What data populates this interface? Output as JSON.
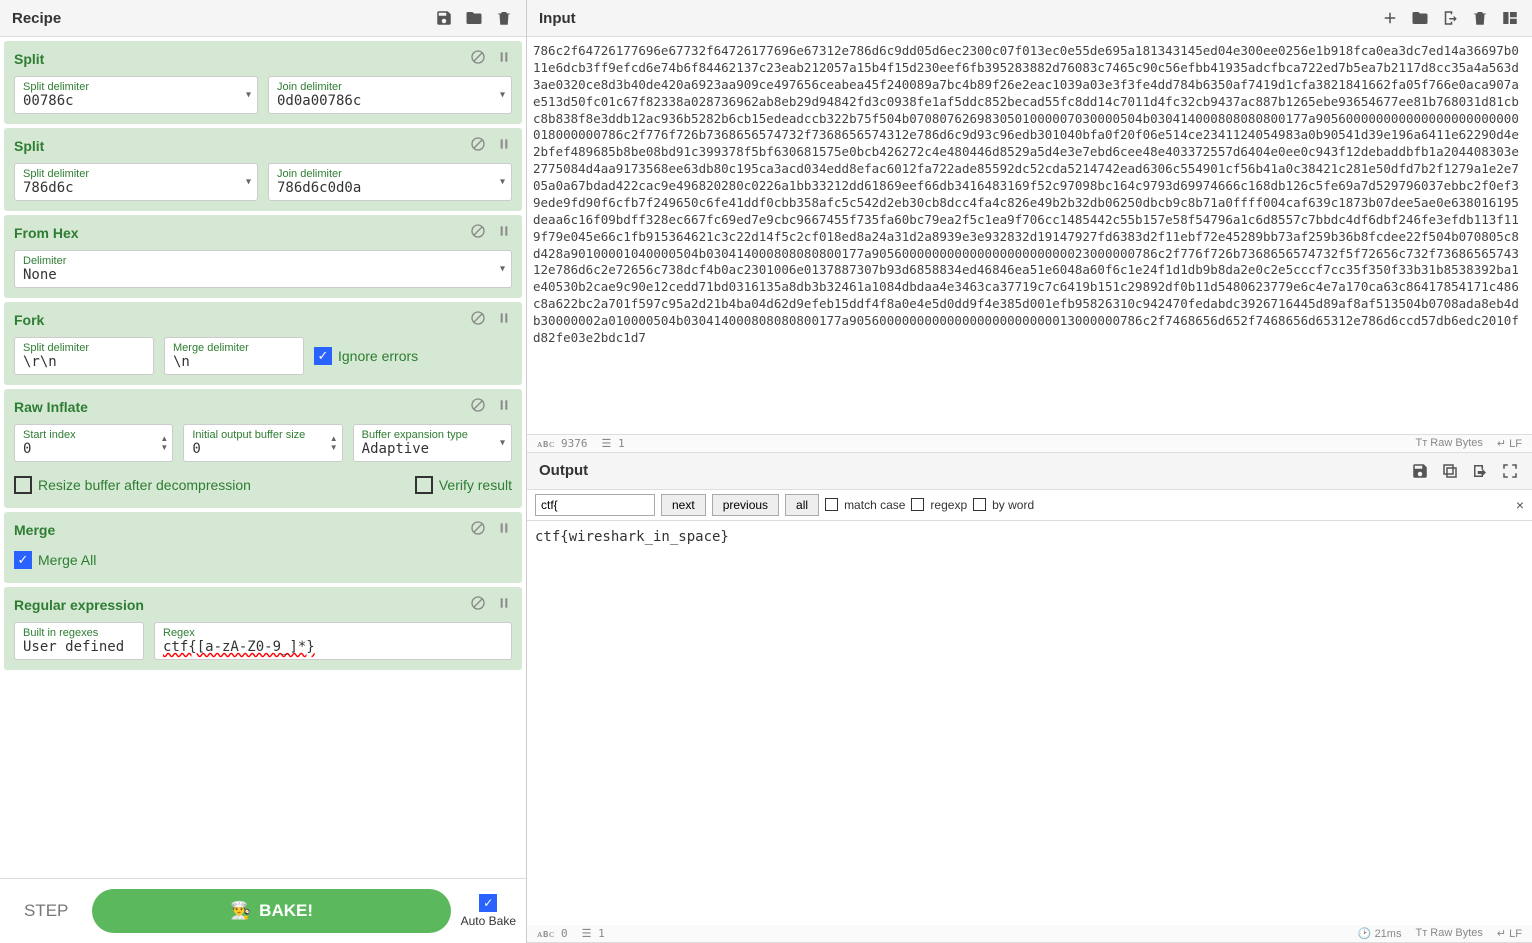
{
  "recipe": {
    "title": "Recipe",
    "ops": [
      {
        "name": "Split",
        "fields": [
          {
            "label": "Split delimiter",
            "value": "00786c",
            "dropdown": true
          },
          {
            "label": "Join delimiter",
            "value": "0d0a00786c",
            "dropdown": true
          }
        ]
      },
      {
        "name": "Split",
        "fields": [
          {
            "label": "Split delimiter",
            "value": "786d6c",
            "dropdown": true
          },
          {
            "label": "Join delimiter",
            "value": "786d6c0d0a",
            "dropdown": true
          }
        ]
      },
      {
        "name": "From Hex",
        "fields": [
          {
            "label": "Delimiter",
            "value": "None",
            "dropdown": true,
            "full": true
          }
        ]
      },
      {
        "name": "Fork",
        "fields": [
          {
            "label": "Split delimiter",
            "value": "\\r\\n"
          },
          {
            "label": "Merge delimiter",
            "value": "\\n"
          }
        ],
        "checks": [
          {
            "label": "Ignore errors",
            "checked": true
          }
        ]
      },
      {
        "name": "Raw Inflate",
        "fields": [
          {
            "label": "Start index",
            "value": "0",
            "spinner": true
          },
          {
            "label": "Initial output buffer size",
            "value": "0",
            "spinner": true
          },
          {
            "label": "Buffer expansion type",
            "value": "Adaptive",
            "dropdown": true
          }
        ],
        "postchecks": [
          {
            "label": "Resize buffer after decompression",
            "checked": false
          },
          {
            "label": "Verify result",
            "checked": false
          }
        ]
      },
      {
        "name": "Merge",
        "checks": [
          {
            "label": "Merge All",
            "checked": true
          }
        ]
      },
      {
        "name": "Regular expression",
        "fields": [
          {
            "label": "Built in regexes",
            "value": "User defined",
            "dropdown": true
          },
          {
            "label": "Regex",
            "value": "ctf{[a-zA-Z0-9_]*}",
            "wide": true
          }
        ]
      }
    ],
    "step_label": "STEP",
    "bake_label": "BAKE!",
    "autobake_label": "Auto Bake",
    "autobake_checked": true
  },
  "input": {
    "title": "Input",
    "status": {
      "chars": "9376",
      "lines": "1",
      "encoding": "Raw Bytes",
      "eol": "LF"
    },
    "text": "786c2f64726177696e67732f64726177696e67312e786d6c9dd05d6ec2300c07f013ec0e55de695a181343145ed04e300ee0256e1b918fca0ea3dc7ed14a36697b011e6dcb3ff9efcd6e74b6f84462137c23eab212057a15b4f15d230eef6fb395283882d76083c7465c90c56efbb41935adcfbca722ed7b5ea7b2117d8cc35a4a563d3ae0320ce8d3b40de420a6923aa909ce497656ceabea45f240089a7bc4b89f26e2eac1039a03e3f3fe4dd784b6350af7419d1cfa3821841662fa05f766e0aca907ae513d50fc01c67f82338a028736962ab8eb29d94842fd3c0938fe1af5ddc852becad55fc8dd14c7011d4fc32cb9437ac887b1265ebe93654677ee81b768031d81cbc8b838f8e3ddb12ac936b5282b6cb15edeadccb322b75f504b0708076269830501000007030000504b030414000808080800177a905600000000000000000000000018000000786c2f776f726b7368656574732f7368656574312e786d6c9d93c96edb301040bfa0f20f06e514ce2341124054983a0b90541d39e196a6411e62290d4e2bfef489685b8be08bd91c399378f5bf630681575e0bcb426272c4e480446d8529a5d4e3e7ebd6cee48e403372557d6404e0ee0c943f12debaddbfb1a204408303e2775084d4aa9173568ee63db80c195ca3acd034edd8efac6012fa722ade85592dc52cda5214742ead6306c554901cf56b41a0c38421c281e50dfd7b2f1279a1e2e705a0a67bdad422cac9e496820280c0226a1bb33212dd61869eef66db3416483169f52c97098bc164c9793d69974666c168db126c5fe69a7d529796037ebbc2f0ef39ede9fd90f6cfb7f249650c6fe41ddf0cbb358afc5c542d2eb30cb8dcc4fa4c826e49b2b32db06250dbcb9c8b71a0ffff004caf639c1873b07dee5ae0e638016195deaa6c16f09bdff328ec667fc69ed7e9cbc9667455f735fa60bc79ea2f5c1ea9f706cc1485442c55b157e58f54796a1c6d8557c7bbdc4df6dbf246fe3efdb113f119f79e045e66c1fb915364621c3c22d14f5c2cf018ed8a24a31d2a8939e3e932832d19147927fd6383d2f11ebf72e45289bb73af259b36b8fcdee22f504b070805c8d428a90100001040000504b030414000808080800177a90560000000000000000000000023000000786c2f776f726b7368656574732f5f72656c732f7368656574312e786d6c2e72656c738dcf4b0ac2301006e0137887307b93d6858834ed46846ea51e6048a60f6c1e24f1d1db9b8da2e0c2e5cccf7cc35f350f33b31b8538392ba1e40530b2cae9c90e12cedd71bd0316135a8db3b32461a1084dbdaa4e3463ca37719c7c6419b151c29892df0b11d5480623779e6c4e7a170ca63c86417854171c486c8a622bc2a701f597c95a2d21b4ba04d62d9efeb15ddf4f8a0e4e5d0dd9f4e385d001efb95826310c942470fedabdc3926716445d89af8af513504b0708ada8eb4db30000002a010000504b030414000808080800177a905600000000000000000000000013000000786c2f7468656d652f7468656d65312e786d6ccd57db6edc2010fd82fe03e2bdc1d7"
  },
  "output": {
    "title": "Output",
    "search": {
      "value": "ctf{",
      "buttons": {
        "next": "next",
        "prev": "previous",
        "all": "all"
      },
      "opts": {
        "match": "match case",
        "regex": "regexp",
        "word": "by word"
      }
    },
    "text": "ctf{wireshark_in_space}",
    "status": {
      "time": "21ms",
      "chars": "0",
      "lines": "1",
      "encoding": "Raw Bytes",
      "eol": "LF"
    }
  }
}
